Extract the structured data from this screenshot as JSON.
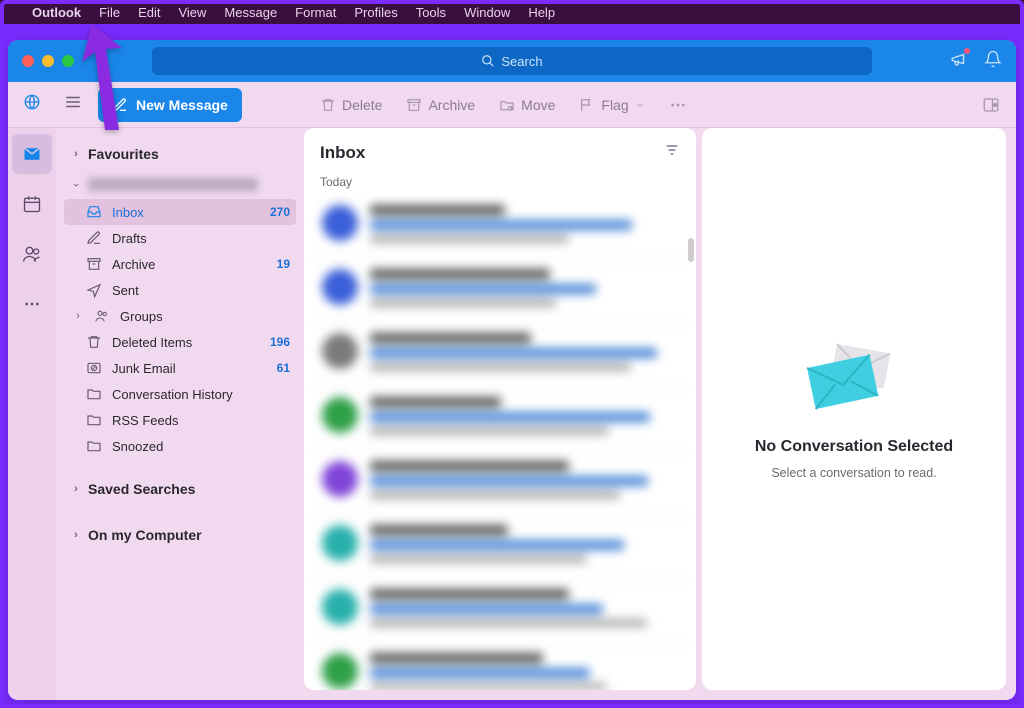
{
  "menubar": {
    "app": "Outlook",
    "items": [
      "File",
      "Edit",
      "View",
      "Message",
      "Format",
      "Profiles",
      "Tools",
      "Window",
      "Help"
    ]
  },
  "titlebar": {
    "search_placeholder": "Search"
  },
  "toolbar": {
    "new_message": "New Message",
    "delete": "Delete",
    "archive": "Archive",
    "move": "Move",
    "flag": "Flag"
  },
  "folders": {
    "favourites": "Favourites",
    "inbox": {
      "label": "Inbox",
      "count": "270"
    },
    "drafts": {
      "label": "Drafts"
    },
    "archive": {
      "label": "Archive",
      "count": "19"
    },
    "sent": {
      "label": "Sent"
    },
    "groups": {
      "label": "Groups"
    },
    "deleted": {
      "label": "Deleted Items",
      "count": "196"
    },
    "junk": {
      "label": "Junk Email",
      "count": "61"
    },
    "conversation_history": {
      "label": "Conversation History"
    },
    "rss": {
      "label": "RSS Feeds"
    },
    "snoozed": {
      "label": "Snoozed"
    },
    "saved_searches": "Saved Searches",
    "on_my_computer": "On my Computer"
  },
  "message_list": {
    "title": "Inbox",
    "group_today": "Today"
  },
  "reading_pane": {
    "title": "No Conversation Selected",
    "subtitle": "Select a conversation to read."
  },
  "avatar_colors": [
    "#3a5fd9",
    "#3a5fd9",
    "#7a7a7a",
    "#2fa048",
    "#8045d9",
    "#27b0ac",
    "#27b0ac",
    "#2fa048"
  ]
}
